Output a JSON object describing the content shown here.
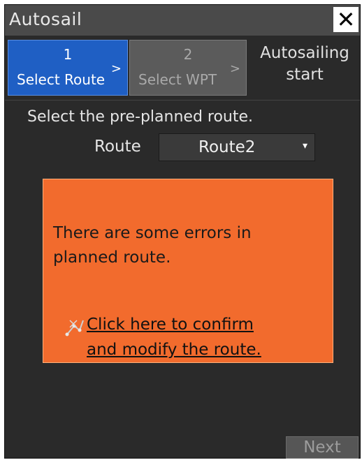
{
  "window": {
    "title": "Autosail",
    "close_icon": "close-icon"
  },
  "steps": [
    {
      "number": "1",
      "label": "Select Route",
      "chevron": ">"
    },
    {
      "number": "2",
      "label": "Select WPT",
      "chevron": ">"
    }
  ],
  "step3": {
    "line1": "Autosailing",
    "line2": "start"
  },
  "main": {
    "instruction": "Select the pre-planned route.",
    "route_label": "Route",
    "route_value": "Route2",
    "route_arrow_icon": "dropdown-arrow-icon"
  },
  "error": {
    "line1": "There are some errors in",
    "line2": "planned route.",
    "link_line1": "Click here to confirm",
    "link_line2": "and modify the route.",
    "link_icon": "route-edit-icon",
    "color": "#f26b2d"
  },
  "footer": {
    "next_label": "Next"
  },
  "colors": {
    "accent": "#1f5fc4",
    "background": "#2a2a2a"
  }
}
